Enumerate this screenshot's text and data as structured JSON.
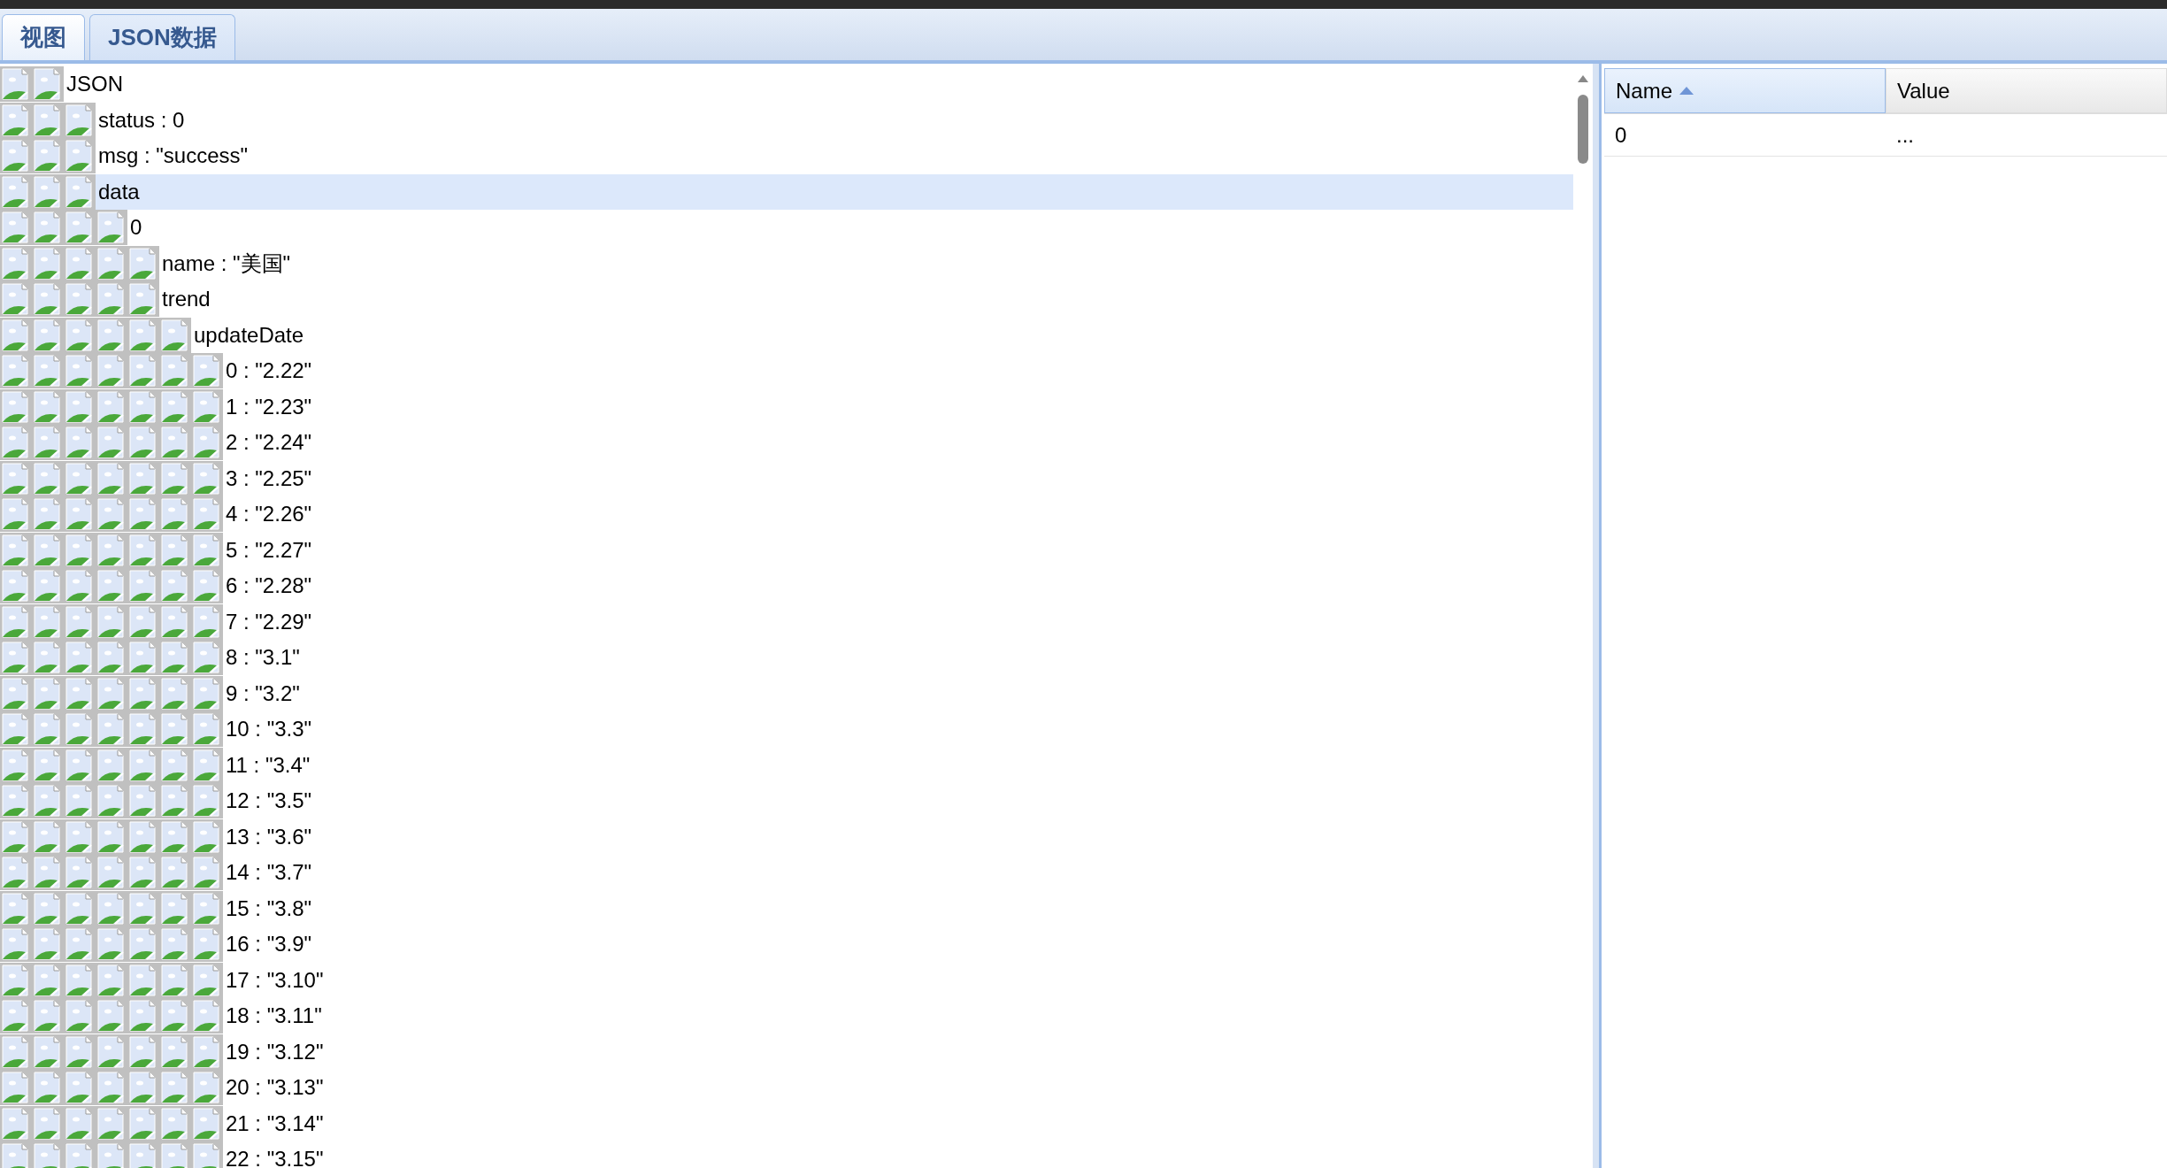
{
  "tabs": [
    {
      "label": "视图",
      "selected": true
    },
    {
      "label": "JSON数据",
      "selected": false
    }
  ],
  "tree": [
    {
      "label": "JSON",
      "selected": false,
      "children": [
        {
          "label": "status : 0",
          "selected": false
        },
        {
          "label": "msg : \"success\"",
          "selected": false
        },
        {
          "label": "data",
          "selected": true,
          "children": [
            {
              "label": "0",
              "selected": false,
              "children": [
                {
                  "label": "name : \"美国\"",
                  "selected": false
                },
                {
                  "label": "trend",
                  "selected": false,
                  "children": [
                    {
                      "label": "updateDate",
                      "selected": false,
                      "children": [
                        {
                          "label": "0 : \"2.22\"",
                          "selected": false
                        },
                        {
                          "label": "1 : \"2.23\"",
                          "selected": false
                        },
                        {
                          "label": "2 : \"2.24\"",
                          "selected": false
                        },
                        {
                          "label": "3 : \"2.25\"",
                          "selected": false
                        },
                        {
                          "label": "4 : \"2.26\"",
                          "selected": false
                        },
                        {
                          "label": "5 : \"2.27\"",
                          "selected": false
                        },
                        {
                          "label": "6 : \"2.28\"",
                          "selected": false
                        },
                        {
                          "label": "7 : \"2.29\"",
                          "selected": false
                        },
                        {
                          "label": "8 : \"3.1\"",
                          "selected": false
                        },
                        {
                          "label": "9 : \"3.2\"",
                          "selected": false
                        },
                        {
                          "label": "10 : \"3.3\"",
                          "selected": false
                        },
                        {
                          "label": "11 : \"3.4\"",
                          "selected": false
                        },
                        {
                          "label": "12 : \"3.5\"",
                          "selected": false
                        },
                        {
                          "label": "13 : \"3.6\"",
                          "selected": false
                        },
                        {
                          "label": "14 : \"3.7\"",
                          "selected": false
                        },
                        {
                          "label": "15 : \"3.8\"",
                          "selected": false
                        },
                        {
                          "label": "16 : \"3.9\"",
                          "selected": false
                        },
                        {
                          "label": "17 : \"3.10\"",
                          "selected": false
                        },
                        {
                          "label": "18 : \"3.11\"",
                          "selected": false
                        },
                        {
                          "label": "19 : \"3.12\"",
                          "selected": false
                        },
                        {
                          "label": "20 : \"3.13\"",
                          "selected": false
                        },
                        {
                          "label": "21 : \"3.14\"",
                          "selected": false
                        },
                        {
                          "label": "22 : \"3.15\"",
                          "selected": false
                        }
                      ]
                    }
                  ]
                }
              ]
            }
          ]
        }
      ]
    }
  ],
  "table": {
    "columns": [
      {
        "label": "Name",
        "sorted": true
      },
      {
        "label": "Value",
        "sorted": false
      }
    ],
    "rows": [
      [
        "0",
        "..."
      ]
    ]
  }
}
